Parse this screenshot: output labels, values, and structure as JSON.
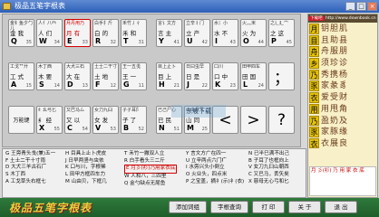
{
  "window": {
    "title": "极品五笔字根表"
  },
  "rows": [
    [
      {
        "letter": "Q",
        "roots": "金钅鱼夕勹儿",
        "chars": "金 我",
        "code": "35"
      },
      {
        "letter": "W",
        "roots": "人亻八癶",
        "chars": "人 们",
        "code": "34"
      },
      {
        "letter": "E",
        "roots": "月丹用乃",
        "chars": "月 有",
        "code": "33",
        "hl": true
      },
      {
        "letter": "R",
        "roots": "白手扌斤",
        "chars": "白 的",
        "code": "32"
      },
      {
        "letter": "T",
        "roots": "禾竹丿彳",
        "chars": "禾 和",
        "code": "31"
      },
      {
        "letter": "Y",
        "roots": "言讠文方",
        "chars": "言 主",
        "code": "41"
      },
      {
        "letter": "U",
        "roots": "立辛丬门",
        "chars": "立 产",
        "code": "42"
      },
      {
        "letter": "I",
        "roots": "水氵小",
        "chars": "水 不",
        "code": "43"
      },
      {
        "letter": "O",
        "roots": "火灬米",
        "chars": "火 为",
        "code": "44"
      },
      {
        "letter": "P",
        "roots": "之辶廴宀",
        "chars": "之 这",
        "code": "45"
      }
    ],
    [
      {
        "letter": "A",
        "roots": "工戈艹廾",
        "chars": "工 式",
        "code": "15"
      },
      {
        "letter": "S",
        "roots": "木丁西",
        "chars": "木 要",
        "code": "14"
      },
      {
        "letter": "D",
        "roots": "大犬三石",
        "chars": "大 在",
        "code": "13"
      },
      {
        "letter": "F",
        "roots": "土士二干寸",
        "chars": "土 地",
        "code": "12"
      },
      {
        "letter": "G",
        "roots": "王一五戋",
        "chars": "王 一",
        "code": "11"
      },
      {
        "letter": "H",
        "roots": "目上止卜",
        "chars": "目 上",
        "code": "21"
      },
      {
        "letter": "J",
        "roots": "日曰虫早",
        "chars": "日 是",
        "code": "22"
      },
      {
        "letter": "K",
        "roots": "口川",
        "chars": "口 中",
        "code": "23"
      },
      {
        "letter": "L",
        "roots": "田甲四车",
        "chars": "田 国",
        "code": "24"
      }
    ],
    [
      {
        "letter": "Z",
        "roots": "",
        "chars": "万能键",
        "code": ""
      },
      {
        "letter": "X",
        "roots": "纟幺弓匕",
        "chars": "纟 经",
        "code": "55"
      },
      {
        "letter": "C",
        "roots": "又巴马厶",
        "chars": "又 以",
        "code": "54"
      },
      {
        "letter": "V",
        "roots": "女刀九臼",
        "chars": "女 发",
        "code": "53"
      },
      {
        "letter": "B",
        "roots": "子孑耳阝",
        "chars": "子 了",
        "code": "52"
      },
      {
        "letter": "N",
        "roots": "已己尸心",
        "chars": "已 民",
        "code": "51"
      },
      {
        "letter": "M",
        "roots": "山由贝几",
        "chars": "山 同",
        "code": "25"
      }
    ]
  ],
  "symkeys": [
    "<",
    ">",
    "?"
  ],
  "semicolon": "；",
  "quote": "“",
  "phrases": {
    "col1": [
      "G 王旁青头戋(兼)五一",
      "F 土士二干十寸雨",
      "D 大犬三羊古石厂",
      "S 木丁西",
      "A 工戈草头右框七"
    ],
    "col2": [
      "H 目具上止卜虎皮",
      "J 日早两竖与虫依",
      "K 口与川，字根稀",
      "L 田甲方框四车力",
      "M 山由贝，下框几"
    ],
    "col3": [
      "T 禾竹一撇双人立",
      "R 白手看头三二斤",
      "E 月彡(衫)乃用家衣底",
      "W 人和八，三四里",
      "Q 金勺缺点无尾鱼"
    ],
    "col4": [
      "Y 言文方广在四一",
      "U 立辛两点六门疒",
      "I 水旁兴头小倒立",
      "O 火业头，四点米",
      "P 之宝盖，摘礻(示)衤(衣)"
    ],
    "col5": [
      "N 已半巳满不出己",
      "B 子耳了也框向上",
      "V 女刀九臼山朝西",
      "C 又巴马，丢矢矣",
      "X 慈母无心弓和匕"
    ]
  },
  "highlight_phrase": "E 月彡(衫)乃用家衣底",
  "watermark": "东坡下载",
  "bottom": {
    "logo": "极品五笔字根表",
    "buttons": [
      "添加词组",
      "字根查询",
      "打 印",
      "关 于",
      "退 出"
    ]
  },
  "rightpanel": {
    "header_label": "下载吧",
    "header_url": "http://www.downbook.cn",
    "rows": [
      {
        "label": "月",
        "chars": "钥胆肌"
      },
      {
        "label": "目",
        "chars": "且助县"
      },
      {
        "label": "舟",
        "chars": "舟服朋"
      },
      {
        "label": "乡",
        "chars": "须珍诊"
      },
      {
        "label": "乃",
        "chars": "秀携杨"
      },
      {
        "label": "豕",
        "chars": "家彖豸"
      },
      {
        "label": "衣",
        "chars": "爱受财"
      },
      {
        "label": "用",
        "chars": "用甩角"
      },
      {
        "label": "乃",
        "chars": "盈奶及"
      },
      {
        "label": "豕",
        "chars": "家豚缘"
      },
      {
        "label": "衣",
        "chars": "衣展良"
      }
    ],
    "bottom_text": "月 彡(衫) 乃 用 家 衣 底"
  }
}
